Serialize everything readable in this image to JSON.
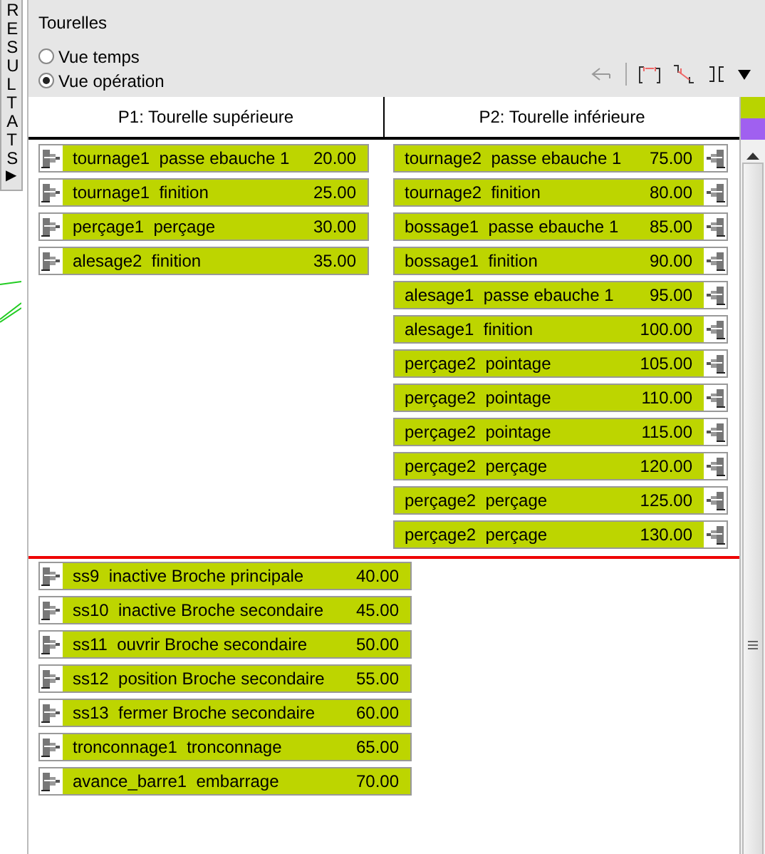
{
  "side_tab": {
    "label": "RESULTATS",
    "arrow": "▶"
  },
  "panel": {
    "title": "Tourelles"
  },
  "view_options": [
    {
      "label": "Vue temps",
      "selected": false
    },
    {
      "label": "Vue opération",
      "selected": true
    }
  ],
  "columns": [
    {
      "title": "P1: Tourelle supérieure",
      "kind": "icon-left",
      "operations": [
        {
          "part": "tournage1",
          "operation": "passe ebauche 1",
          "time": "20.00"
        },
        {
          "part": "tournage1",
          "operation": "finition",
          "time": "25.00"
        },
        {
          "part": "perçage1",
          "operation": "perçage",
          "time": "30.00"
        },
        {
          "part": "alesage2",
          "operation": "finition",
          "time": "35.00"
        }
      ]
    },
    {
      "title": "P2: Tourelle inférieure",
      "kind": "icon-right",
      "operations": [
        {
          "part": "tournage2",
          "operation": "passe ebauche 1",
          "time": "75.00"
        },
        {
          "part": "tournage2",
          "operation": "finition",
          "time": "80.00"
        },
        {
          "part": "bossage1",
          "operation": "passe ebauche 1",
          "time": "85.00"
        },
        {
          "part": "bossage1",
          "operation": "finition",
          "time": "90.00"
        },
        {
          "part": "alesage1",
          "operation": "passe ebauche 1",
          "time": "95.00"
        },
        {
          "part": "alesage1",
          "operation": "finition",
          "time": "100.00"
        },
        {
          "part": "perçage2",
          "operation": "pointage",
          "time": "105.00"
        },
        {
          "part": "perçage2",
          "operation": "pointage",
          "time": "110.00"
        },
        {
          "part": "perçage2",
          "operation": "pointage",
          "time": "115.00"
        },
        {
          "part": "perçage2",
          "operation": "perçage",
          "time": "120.00"
        },
        {
          "part": "perçage2",
          "operation": "perçage",
          "time": "125.00"
        },
        {
          "part": "perçage2",
          "operation": "perçage",
          "time": "130.00"
        }
      ]
    }
  ],
  "spindle_operations": [
    {
      "part": "ss9",
      "operation": "inactive Broche principale",
      "time": "40.00"
    },
    {
      "part": "ss10",
      "operation": "inactive Broche secondaire",
      "time": "45.00"
    },
    {
      "part": "ss11",
      "operation": "ouvrir Broche secondaire",
      "time": "50.00"
    },
    {
      "part": "ss12",
      "operation": "position Broche secondaire",
      "time": "55.00"
    },
    {
      "part": "ss13",
      "operation": "fermer Broche secondaire",
      "time": "60.00"
    },
    {
      "part": "tronconnage1",
      "operation": "tronconnage",
      "time": "65.00"
    },
    {
      "part": "avance_barre1",
      "operation": "embarrage",
      "time": "70.00"
    }
  ]
}
